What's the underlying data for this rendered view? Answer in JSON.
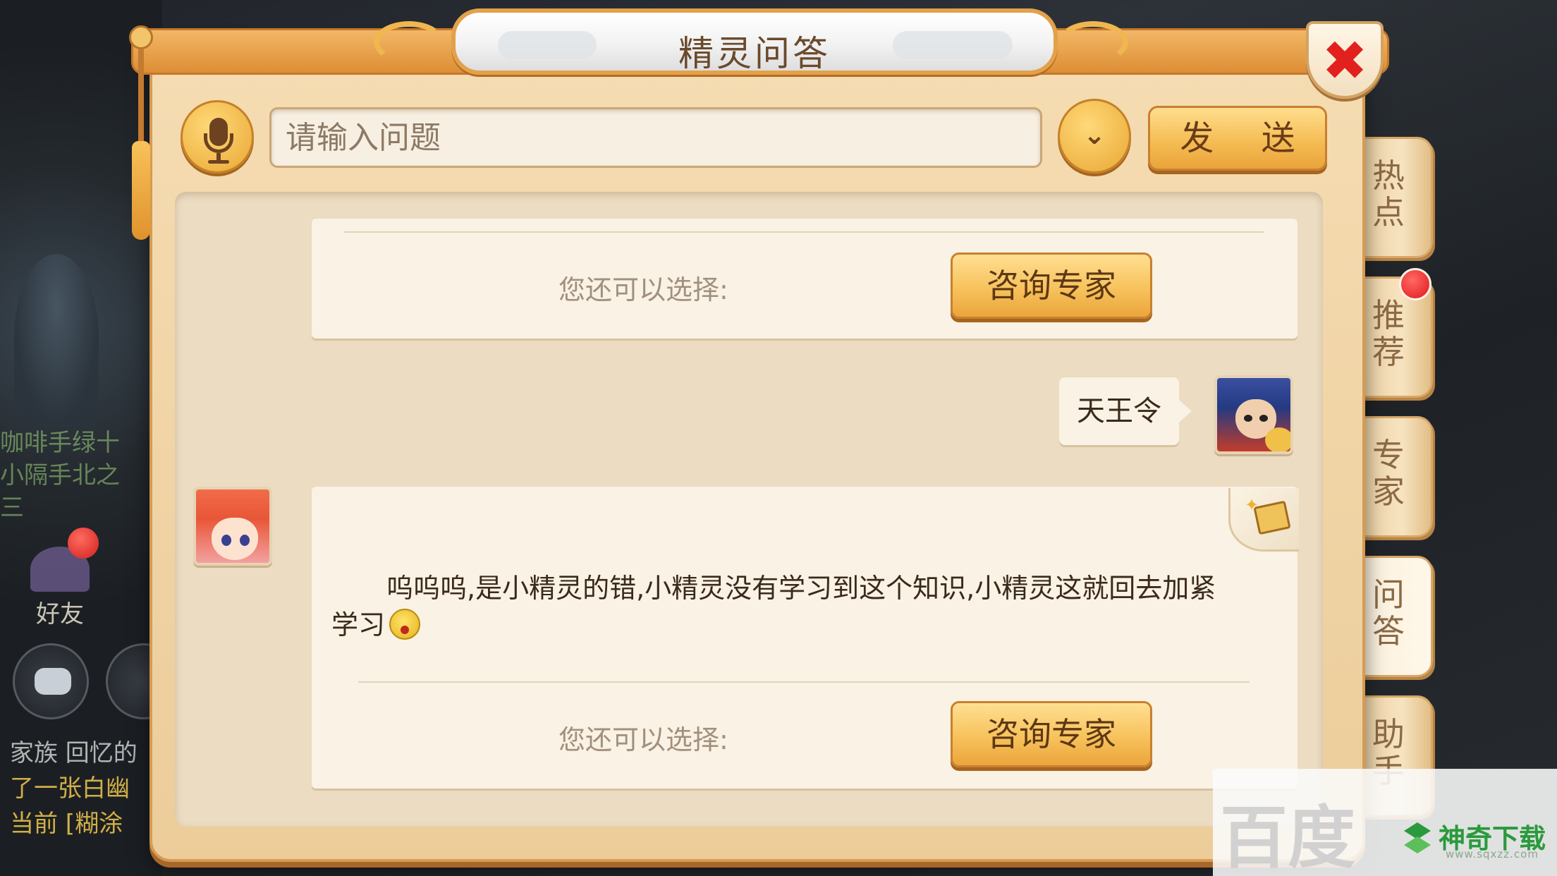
{
  "window": {
    "title": "精灵问答",
    "close_glyph": "✖"
  },
  "search": {
    "placeholder": "请输入问题",
    "send_label": "发 送",
    "dropdown_glyph": "⌄"
  },
  "side_tabs": [
    {
      "label": "热点"
    },
    {
      "label": "推荐",
      "has_dot": true
    },
    {
      "label": "专家"
    },
    {
      "label": "问答",
      "active": true
    },
    {
      "label": "助手"
    }
  ],
  "conversation": {
    "first_card": {
      "choose_label": "您还可以选择:",
      "consult_label": "咨询专家"
    },
    "user_message": "天王令",
    "sprite_message": "呜呜呜,是小精灵的错,小精灵没有学习到这个知识,小精灵这就回去加紧学习",
    "second_card": {
      "choose_label": "您还可以选择:",
      "consult_label": "咨询专家"
    }
  },
  "background": {
    "chat_lines": [
      "咖啡手绿十",
      "小隔手北之",
      "三"
    ],
    "friend_label": "好友",
    "log_lines": [
      "家族 回忆的",
      "了一张白幽",
      "当前 [糊涂"
    ]
  },
  "watermark": {
    "baidu": "百度",
    "brand": "神奇下载",
    "url": "www.sqxzz.com"
  },
  "icons": {
    "mic": "microphone-icon",
    "dropdown": "chevron-down-icon",
    "close": "close-icon",
    "book": "book-icon",
    "emoji": "crying-emoji-icon"
  },
  "colors": {
    "accent": "#f5bd55",
    "close_red": "#e2201e",
    "panel": "#ebdcc2",
    "notification_red": "#e0161d"
  }
}
